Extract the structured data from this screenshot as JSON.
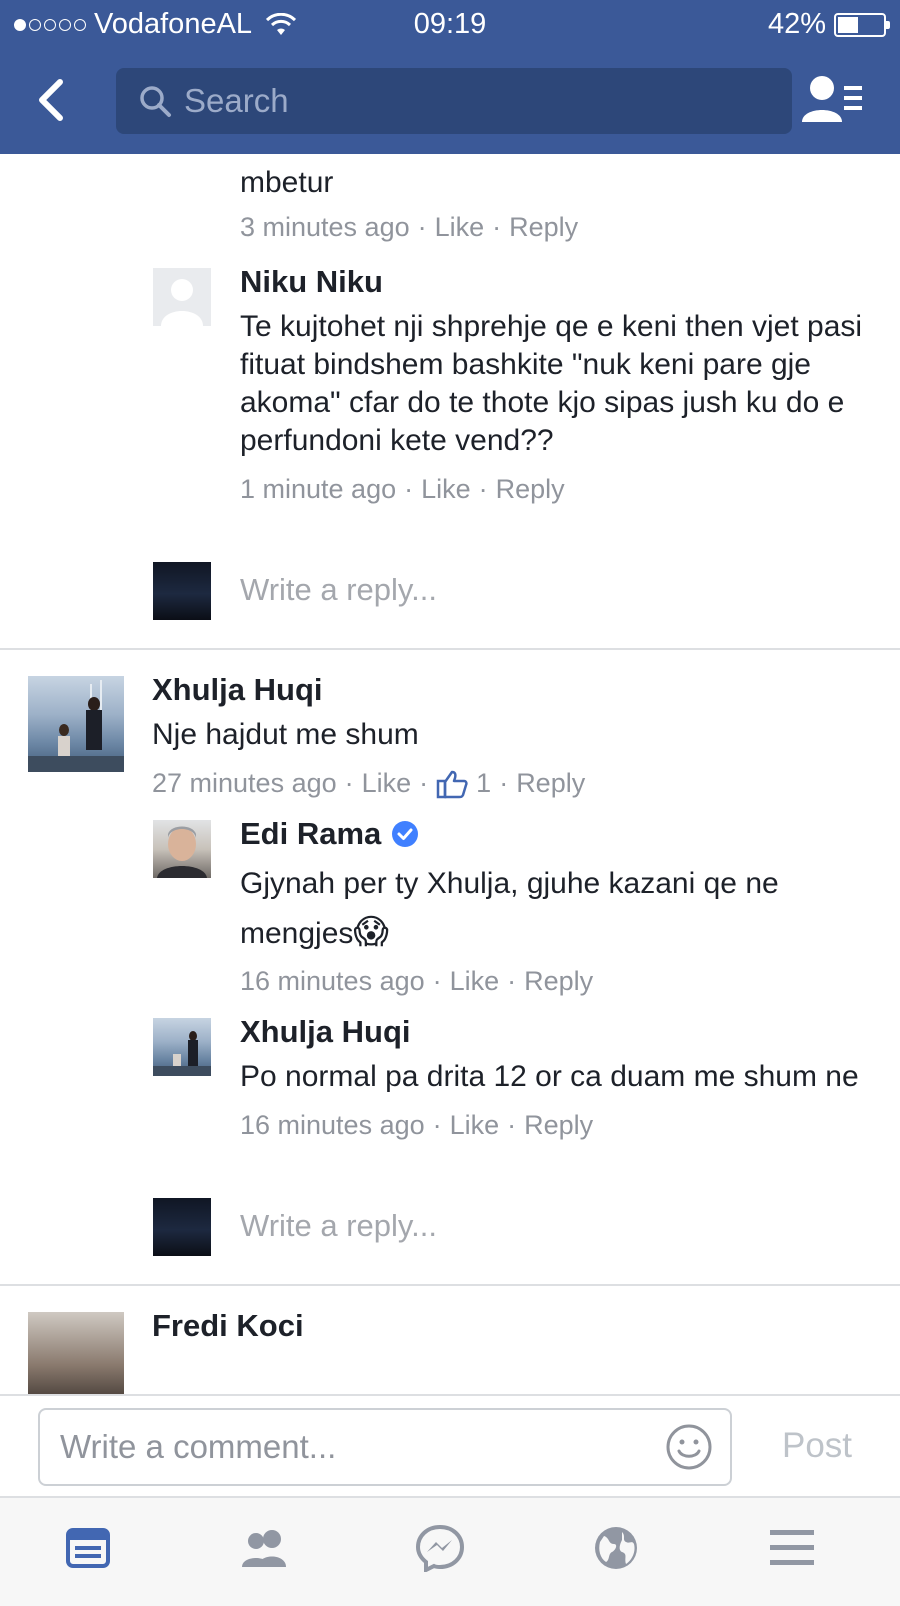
{
  "status_bar": {
    "carrier": "VodafoneAL",
    "time": "09:19",
    "battery": "42%",
    "battery_level": 0.42,
    "signal_bars": 1
  },
  "nav": {
    "search_placeholder": "Search",
    "icons": [
      "chevron-left-icon",
      "search-icon",
      "friends-list-icon"
    ]
  },
  "comments": {
    "clipped": {
      "text_tail": "mbetur",
      "time": "3 minutes ago",
      "like": "Like",
      "reply": "Reply"
    },
    "niku": {
      "name": "Niku Niku",
      "text": "Te kujtohet nji shprehje qe e keni then vjet pasi fituat bindshem bashkite \"nuk keni pare gje akoma\" cfar do te thote kjo sipas jush ku do e perfundoni kete vend??",
      "time": "1 minute ago",
      "like": "Like",
      "reply": "Reply"
    },
    "write_reply_1": "Write a reply...",
    "xhulja_top": {
      "name": "Xhulja Huqi",
      "text": "Nje hajdut me shum",
      "time": "27 minutes ago",
      "like": "Like",
      "like_count": "1",
      "reply": "Reply"
    },
    "edi": {
      "name": "Edi Rama",
      "verified": true,
      "text": "Gjynah per ty Xhulja, gjuhe kazani qe ne mengjes",
      "emoji": "😱",
      "time": "16 minutes ago",
      "like": "Like",
      "reply": "Reply"
    },
    "xhulja_reply": {
      "name": "Xhulja Huqi",
      "text": "Po normal pa drita 12 or ca duam me shum ne",
      "time": "16 minutes ago",
      "like": "Like",
      "reply": "Reply"
    },
    "write_reply_2": "Write a reply...",
    "fredi": {
      "name": "Fredi Koci"
    }
  },
  "composer": {
    "placeholder": "Write a comment...",
    "post_label": "Post"
  },
  "tabbar": {
    "items": [
      "news-feed-icon",
      "friends-icon",
      "messenger-icon",
      "notifications-globe-icon",
      "menu-icon"
    ],
    "active": "news-feed-icon"
  },
  "colors": {
    "brand": "#3b5998",
    "search_bg": "#2d4779",
    "meta_text": "#90949c",
    "active_tab": "#4267b2",
    "verified": "#4080ff"
  }
}
